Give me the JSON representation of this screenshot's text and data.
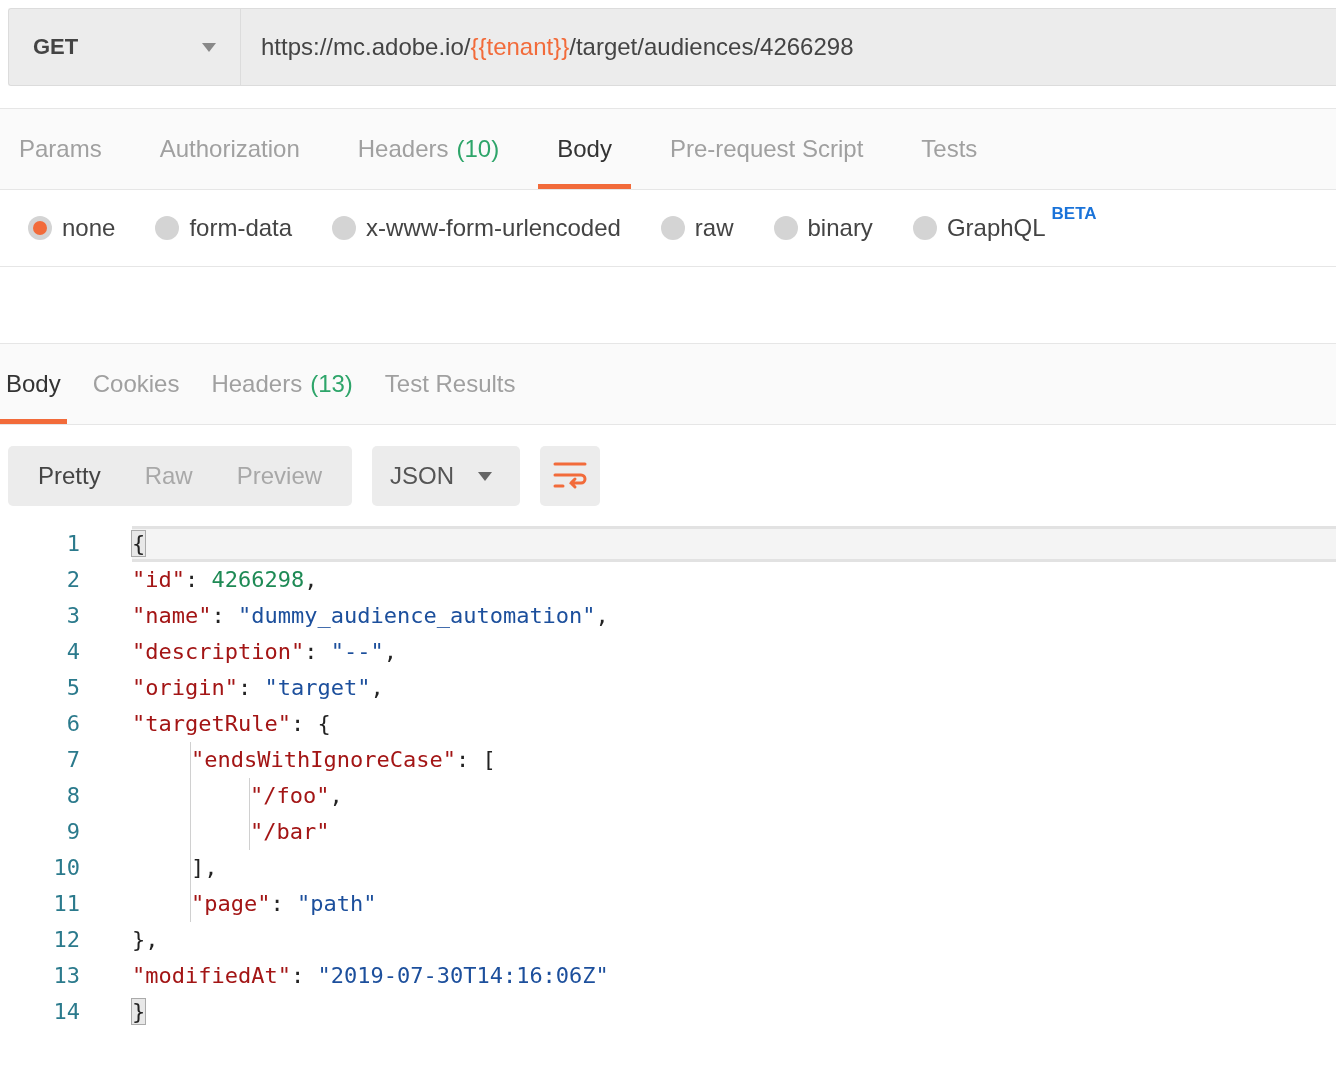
{
  "request": {
    "method": "GET",
    "url": [
      {
        "text": "https://mc.adobe.io/",
        "kind": "plain"
      },
      {
        "text": "{{tenant}}",
        "kind": "variable"
      },
      {
        "text": "/target/audiences/4266298",
        "kind": "plain"
      }
    ]
  },
  "request_tabs": [
    {
      "label": "Params",
      "selected": false
    },
    {
      "label": "Authorization",
      "selected": false
    },
    {
      "label": "Headers",
      "count": "(10)",
      "selected": false
    },
    {
      "label": "Body",
      "selected": true
    },
    {
      "label": "Pre-request Script",
      "selected": false
    },
    {
      "label": "Tests",
      "selected": false
    }
  ],
  "body_types": [
    {
      "label": "none",
      "selected": true
    },
    {
      "label": "form-data",
      "selected": false
    },
    {
      "label": "x-www-form-urlencoded",
      "selected": false
    },
    {
      "label": "raw",
      "selected": false
    },
    {
      "label": "binary",
      "selected": false
    },
    {
      "label": "GraphQL",
      "badge": "BETA",
      "selected": false
    }
  ],
  "response_tabs": [
    {
      "label": "Body",
      "selected": true
    },
    {
      "label": "Cookies",
      "selected": false
    },
    {
      "label": "Headers",
      "count": "(13)",
      "selected": false
    },
    {
      "label": "Test Results",
      "selected": false
    }
  ],
  "view_modes": [
    {
      "label": "Pretty",
      "selected": true
    },
    {
      "label": "Raw",
      "selected": false
    },
    {
      "label": "Preview",
      "selected": false
    }
  ],
  "format": "JSON",
  "editor": {
    "line_numbers": [
      "1",
      "2",
      "3",
      "4",
      "5",
      "6",
      "7",
      "8",
      "9",
      "10",
      "11",
      "12",
      "13",
      "14"
    ],
    "lines": [
      {
        "active": true,
        "tokens": [
          {
            "kind": "punct",
            "text": "{",
            "matched": true
          }
        ],
        "children": [
          {
            "active": false,
            "tokens": [
              {
                "kind": "key",
                "text": "\"id\""
              },
              {
                "kind": "punct",
                "text": ": "
              },
              {
                "kind": "number",
                "text": "4266298"
              },
              {
                "kind": "punct",
                "text": ","
              }
            ]
          },
          {
            "active": false,
            "tokens": [
              {
                "kind": "key",
                "text": "\"name\""
              },
              {
                "kind": "punct",
                "text": ": "
              },
              {
                "kind": "string",
                "text": "\"dummy_audience_automation\""
              },
              {
                "kind": "punct",
                "text": ","
              }
            ]
          },
          {
            "active": false,
            "tokens": [
              {
                "kind": "key",
                "text": "\"description\""
              },
              {
                "kind": "punct",
                "text": ": "
              },
              {
                "kind": "string",
                "text": "\"--\""
              },
              {
                "kind": "punct",
                "text": ","
              }
            ]
          },
          {
            "active": false,
            "tokens": [
              {
                "kind": "key",
                "text": "\"origin\""
              },
              {
                "kind": "punct",
                "text": ": "
              },
              {
                "kind": "string",
                "text": "\"target\""
              },
              {
                "kind": "punct",
                "text": ","
              }
            ]
          },
          {
            "active": false,
            "tokens": [
              {
                "kind": "key",
                "text": "\"targetRule\""
              },
              {
                "kind": "punct",
                "text": ": {"
              }
            ],
            "children": [
              {
                "active": false,
                "tokens": [
                  {
                    "kind": "key",
                    "text": "\"endsWithIgnoreCase\""
                  },
                  {
                    "kind": "punct",
                    "text": ": ["
                  }
                ],
                "children": [
                  {
                    "active": false,
                    "tokens": [
                      {
                        "kind": "key",
                        "text": "\"/foo\""
                      },
                      {
                        "kind": "punct",
                        "text": ","
                      }
                    ]
                  },
                  {
                    "active": false,
                    "tokens": [
                      {
                        "kind": "key",
                        "text": "\"/bar\""
                      }
                    ]
                  }
                ]
              },
              {
                "active": false,
                "tokens": [
                  {
                    "kind": "punct",
                    "text": "],"
                  }
                ]
              },
              {
                "active": false,
                "tokens": [
                  {
                    "kind": "key",
                    "text": "\"page\""
                  },
                  {
                    "kind": "punct",
                    "text": ": "
                  },
                  {
                    "kind": "string",
                    "text": "\"path\""
                  }
                ]
              }
            ]
          },
          {
            "active": false,
            "tokens": [
              {
                "kind": "punct",
                "text": "},"
              }
            ]
          },
          {
            "active": false,
            "tokens": [
              {
                "kind": "key",
                "text": "\"modifiedAt\""
              },
              {
                "kind": "punct",
                "text": ": "
              },
              {
                "kind": "string",
                "text": "\"2019-07-30T14:16:06Z\""
              }
            ]
          }
        ]
      },
      {
        "active": false,
        "tokens": [
          {
            "kind": "punct",
            "text": "}",
            "matched": true
          }
        ]
      }
    ]
  }
}
